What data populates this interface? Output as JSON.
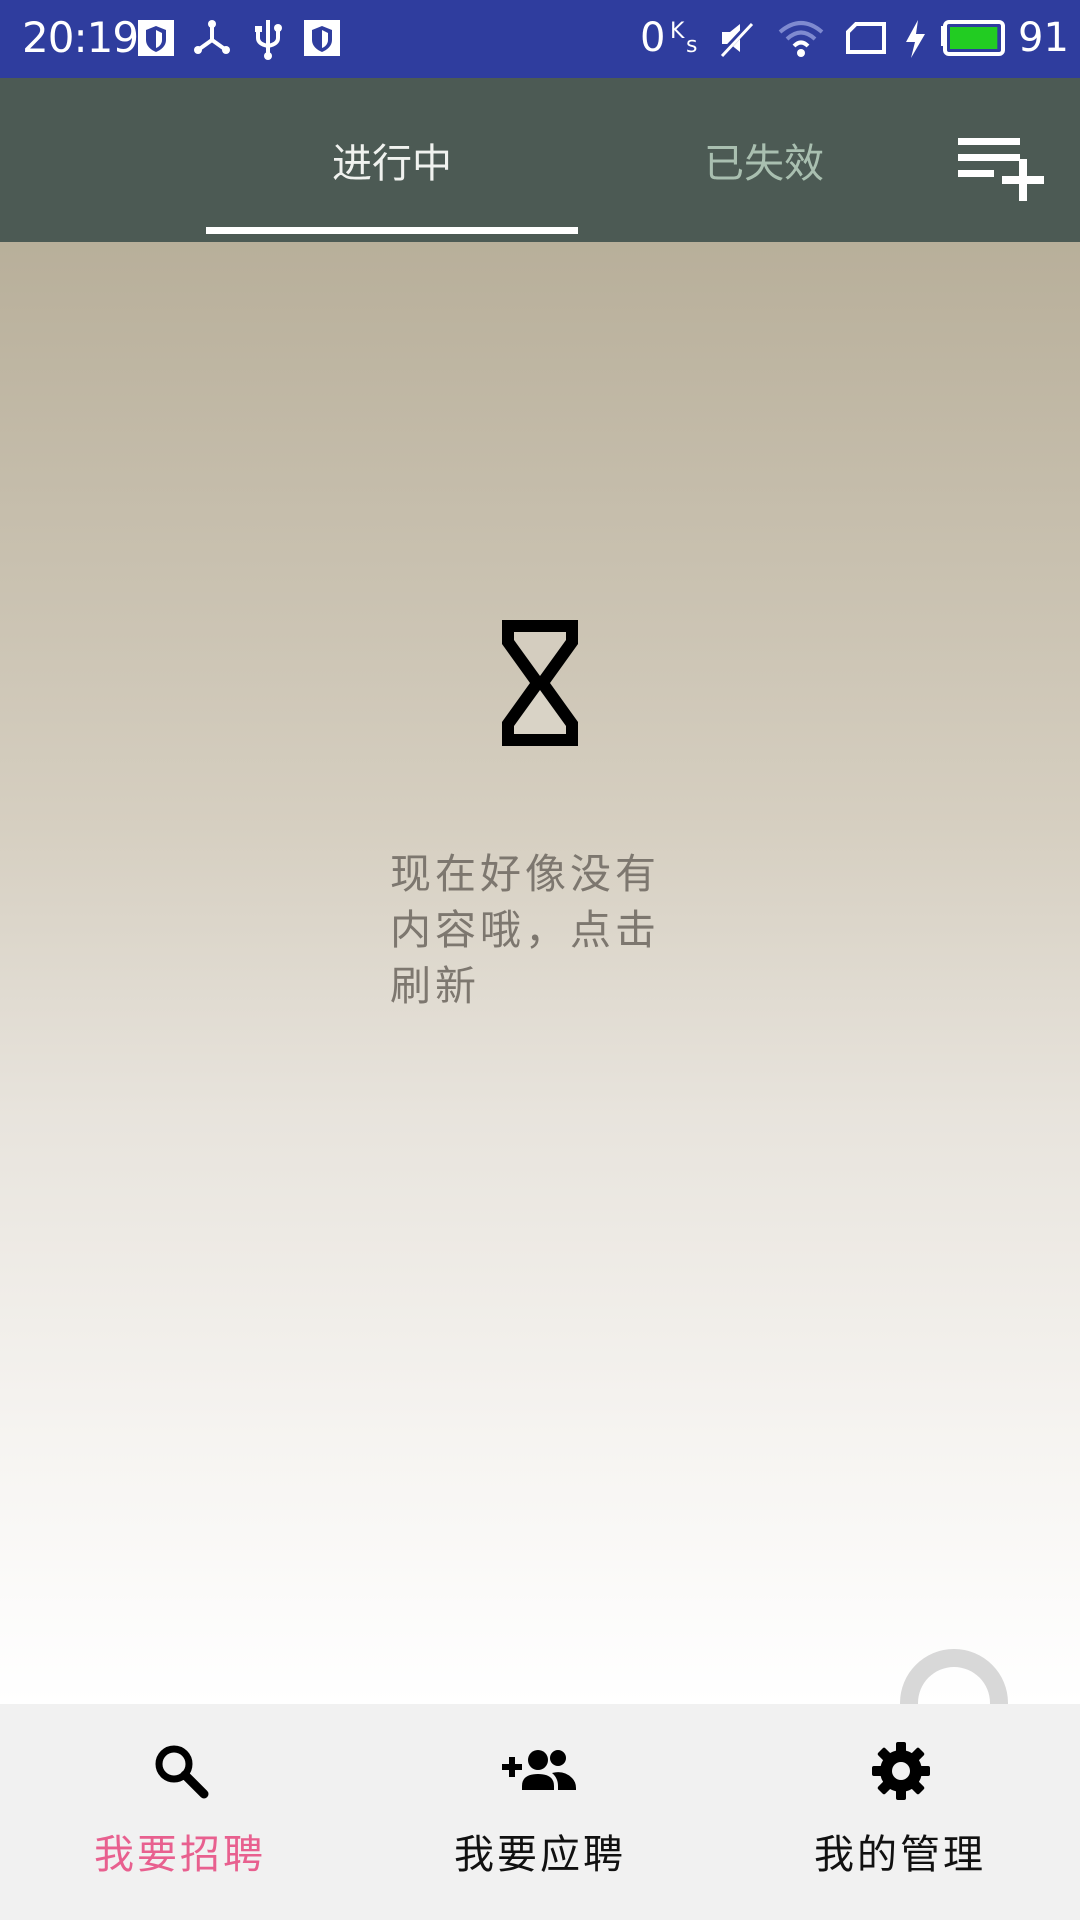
{
  "status_bar": {
    "time": "20:19",
    "net_speed_value": "0",
    "net_speed_unit_top": "K",
    "net_speed_unit_bottom": "s",
    "battery_percent": "91",
    "battery_level": 0.91,
    "battery_color": "#22cc22",
    "icons": [
      "shield-icon",
      "share-icon",
      "usb-icon",
      "shield-icon",
      "mute-icon",
      "wifi-icon",
      "sim-icon",
      "charging-icon",
      "battery-icon"
    ]
  },
  "tabs": {
    "items": [
      {
        "label": "进行中",
        "active": true
      },
      {
        "label": "已失效",
        "active": false
      }
    ],
    "add_icon": "playlist-add-icon"
  },
  "empty_state": {
    "icon": "hourglass-icon",
    "message": "现在好像没有内容哦，点击刷新"
  },
  "bottom_nav": {
    "active_color": "#e8608f",
    "items": [
      {
        "label": "我要招聘",
        "icon": "search-icon",
        "active": true
      },
      {
        "label": "我要应聘",
        "icon": "add-people-icon",
        "active": false
      },
      {
        "label": "我的管理",
        "icon": "gear-icon",
        "active": false
      }
    ]
  }
}
